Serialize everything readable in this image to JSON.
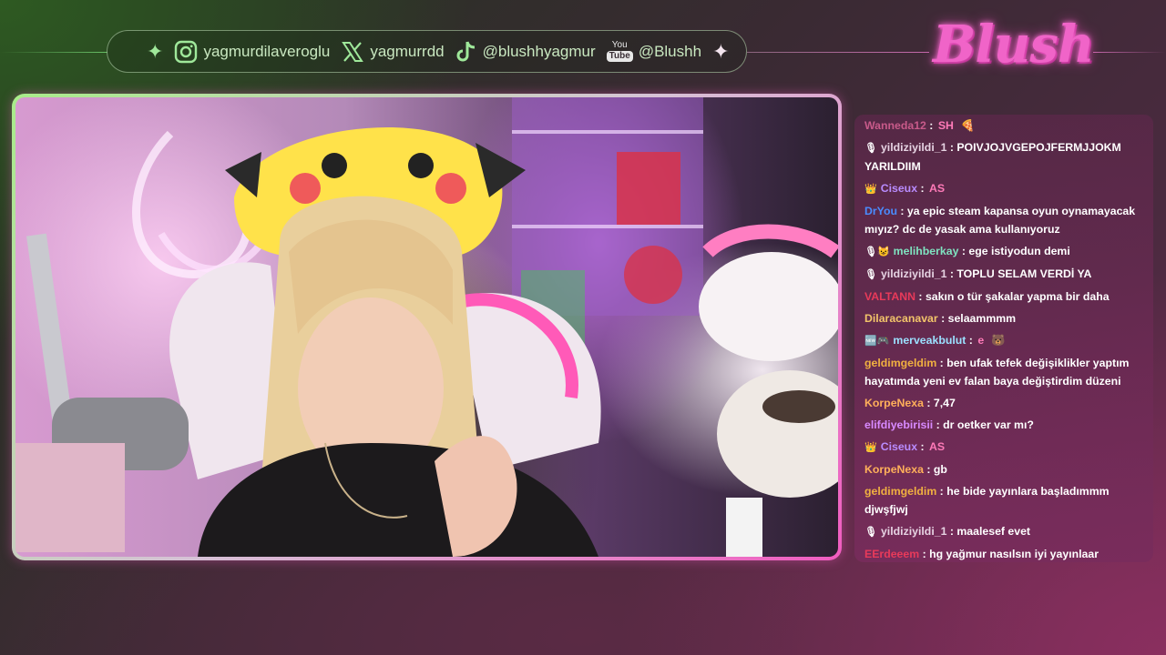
{
  "social_bar": {
    "instagram": "yagmurdilaveroglu",
    "x": "yagmurrdd",
    "tiktok": "@blushhyagmur",
    "youtube_logo_top": "You",
    "youtube_logo_bottom": "Tube",
    "youtube": "@Blushh"
  },
  "logo": {
    "text": "Blush"
  },
  "chat": {
    "messages": [
      {
        "badge": "",
        "user": "Wanneda12",
        "user_color": "#c85a8a",
        "text": "",
        "emote": "SH",
        "emote2": "🍕"
      },
      {
        "badge": "🎙",
        "user": "yildiziyildi_1",
        "user_color": "#e6d3e2",
        "text": "POIVJOJVGEPOJFERMJJOKM YARILDIIM"
      },
      {
        "badge": "👑",
        "user": "Ciseux",
        "user_color": "#b98cff",
        "text": "",
        "emote": "AS"
      },
      {
        "badge": "",
        "user": "DrYou",
        "user_color": "#4a8cff",
        "text": "ya epic steam kapansa oyun oynamayacak mıyız? dc de yasak ama kullanıyoruz"
      },
      {
        "badge": "🎙😺",
        "user": "melihberkay",
        "user_color": "#7fe3c0",
        "text": "ege istiyodun demi"
      },
      {
        "badge": "🎙",
        "user": "yildiziyildi_1",
        "user_color": "#e6d3e2",
        "text": "TOPLU SELAM VERDİ YA"
      },
      {
        "badge": "",
        "user": "VALTANN",
        "user_color": "#e83a5a",
        "text": "sakın o tür şakalar yapma bir daha"
      },
      {
        "badge": "",
        "user": "Dilaracanavar",
        "user_color": "#f2c46a",
        "text": "selaammmm"
      },
      {
        "badge": "🆕🎮",
        "user": "merveakbulut",
        "user_color": "#9be0ff",
        "text": "",
        "emote": "e",
        "emote2": "🐻"
      },
      {
        "badge": "",
        "user": "geldimgeldim",
        "user_color": "#f0b040",
        "text": "ben ufak tefek değişiklikler yaptım hayatımda yeni ev falan baya değiştirdim düzeni"
      },
      {
        "badge": "",
        "user": "KorpeNexa",
        "user_color": "#ffb05a",
        "text": "7,47"
      },
      {
        "badge": "",
        "user": "elifdiyebirisii",
        "user_color": "#d88aff",
        "text": "dr oetker var mı?"
      },
      {
        "badge": "👑",
        "user": "Ciseux",
        "user_color": "#b98cff",
        "text": "",
        "emote": "AS"
      },
      {
        "badge": "",
        "user": "KorpeNexa",
        "user_color": "#ffb05a",
        "text": "gb"
      },
      {
        "badge": "",
        "user": "geldimgeldim",
        "user_color": "#f0b040",
        "text": "he bide yayınlara başladımmm djwşfjwj"
      },
      {
        "badge": "🎙",
        "user": "yildiziyildi_1",
        "user_color": "#e6d3e2",
        "text": "maalesef evet"
      },
      {
        "badge": "",
        "user": "EErdeeem",
        "user_color": "#e83a5a",
        "text": "hg yağmur nasılsın iyi yayınlaar"
      }
    ]
  },
  "colors": {
    "accent_green": "#a8ec8a",
    "accent_pink": "#f05cc0",
    "chat_bg": "#6a2c58"
  }
}
